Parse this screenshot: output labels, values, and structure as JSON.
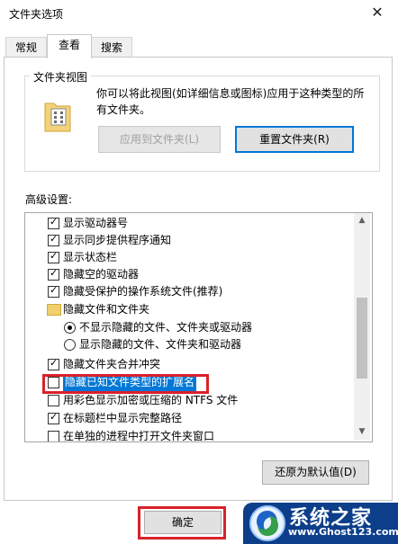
{
  "window": {
    "title": "文件夹选项",
    "close_glyph": "✕"
  },
  "tabs": [
    {
      "label": "常规",
      "active": false
    },
    {
      "label": "查看",
      "active": true
    },
    {
      "label": "搜索",
      "active": false
    }
  ],
  "folder_views": {
    "legend": "文件夹视图",
    "description": "你可以将此视图(如详细信息或图标)应用于这种类型的所有文件夹。",
    "apply_button": "应用到文件夹(L)",
    "reset_button": "重置文件夹(R)"
  },
  "advanced": {
    "label": "高级设置:",
    "items": [
      {
        "kind": "checkbox",
        "checked": true,
        "text": "显示驱动器号"
      },
      {
        "kind": "checkbox",
        "checked": true,
        "text": "显示同步提供程序通知"
      },
      {
        "kind": "checkbox",
        "checked": true,
        "text": "显示状态栏"
      },
      {
        "kind": "checkbox",
        "checked": true,
        "text": "隐藏空的驱动器"
      },
      {
        "kind": "checkbox",
        "checked": true,
        "text": "隐藏受保护的操作系统文件(推荐)"
      },
      {
        "kind": "folder",
        "text": "隐藏文件和文件夹"
      },
      {
        "kind": "radio",
        "checked": true,
        "text": "不显示隐藏的文件、文件夹或驱动器"
      },
      {
        "kind": "radio",
        "checked": false,
        "text": "显示隐藏的文件、文件夹和驱动器"
      },
      {
        "kind": "checkbox",
        "checked": true,
        "text": "隐藏文件夹合并冲突"
      },
      {
        "kind": "checkbox",
        "checked": false,
        "text": "隐藏已知文件类型的扩展名",
        "selected": true
      },
      {
        "kind": "checkbox",
        "checked": false,
        "text": "用彩色显示加密或压缩的 NTFS 文件"
      },
      {
        "kind": "checkbox",
        "checked": true,
        "text": "在标题栏中显示完整路径"
      },
      {
        "kind": "checkbox",
        "checked": false,
        "text": "在单独的进程中打开文件夹窗口"
      }
    ],
    "restore_button": "还原为默认值(D)"
  },
  "footer": {
    "ok_button": "确定"
  },
  "watermark": {
    "title": "系统之家",
    "url": "www.Ghost123.com"
  },
  "colors": {
    "selection": "#0078d7",
    "annotation_red": "#d9212b",
    "watermark_blue": "#0c3e8a"
  }
}
